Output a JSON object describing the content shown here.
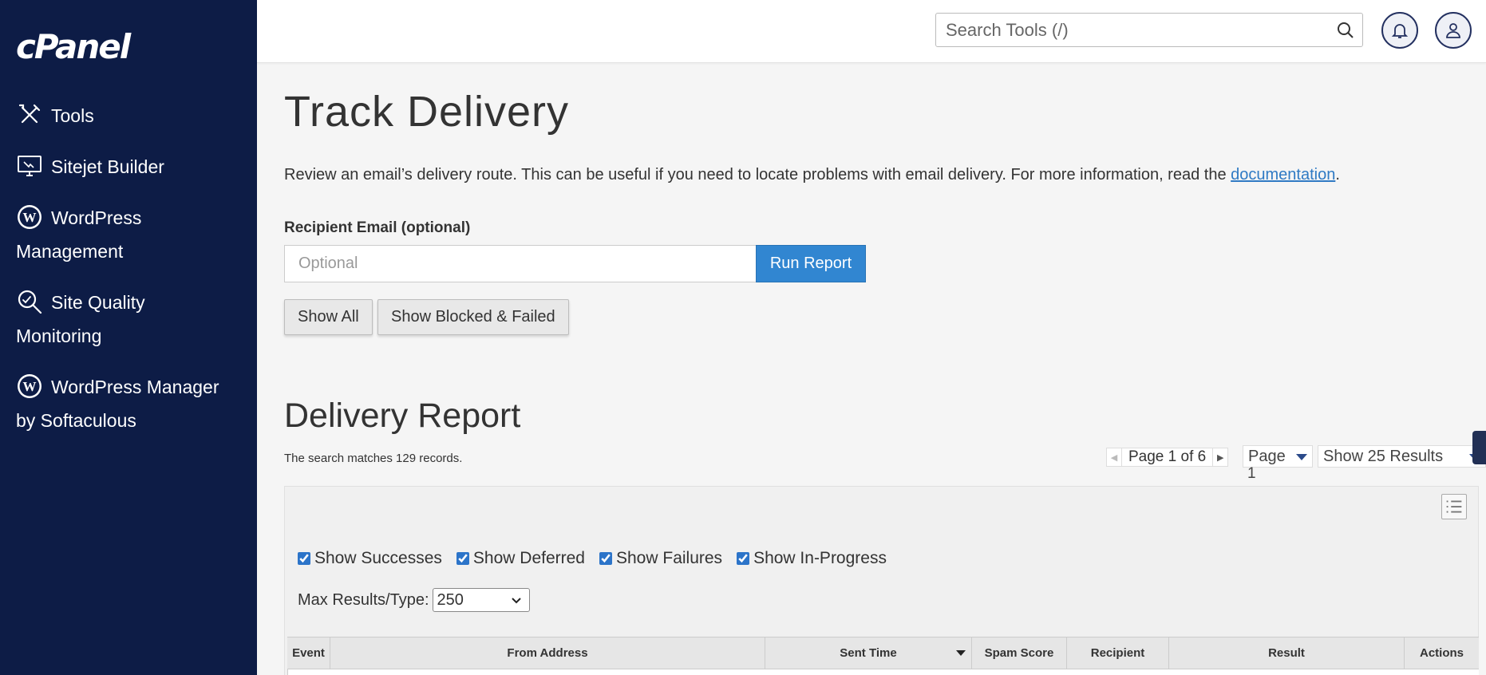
{
  "app": {
    "logo_text": "cPanel"
  },
  "sidebar": {
    "items": [
      {
        "label": "Tools",
        "icon": "tools-icon"
      },
      {
        "label": "Sitejet Builder",
        "icon": "monitor-icon"
      },
      {
        "label": "WordPress",
        "label2": "Management",
        "icon": "wordpress-icon"
      },
      {
        "label": "Site Quality",
        "label2": "Monitoring",
        "icon": "magnifier-icon"
      },
      {
        "label": "WordPress Manager",
        "label2": "by Softaculous",
        "icon": "wordpress-icon"
      }
    ]
  },
  "header": {
    "search_placeholder": "Search Tools (/)",
    "notifications_icon": "bell-icon",
    "user_icon": "user-icon"
  },
  "page": {
    "title": "Track Delivery",
    "description": "Review an email’s delivery route. This can be useful if you need to locate problems with email delivery. For more information, read the ",
    "doc_link": "documentation",
    "description_end": ".",
    "recipient_label": "Recipient Email (optional)",
    "recipient_placeholder": "Optional",
    "run_report": "Run Report",
    "show_all": "Show All",
    "show_blocked": "Show Blocked & Failed"
  },
  "report": {
    "title": "Delivery Report",
    "matches": "The search matches 129 records.",
    "pager_text": "Page 1 of 6",
    "page_select_label": "Page",
    "page_select_value": "1",
    "results_select": "Show 25 Results",
    "filters": [
      {
        "label": "Show Successes",
        "checked": true
      },
      {
        "label": "Show Deferred",
        "checked": true
      },
      {
        "label": "Show Failures",
        "checked": true
      },
      {
        "label": "Show In-Progress",
        "checked": true
      }
    ],
    "max_results_label": "Max Results/Type:",
    "max_results_value": "250",
    "columns": [
      "Event",
      "From Address",
      "Sent Time",
      "Spam Score",
      "Recipient",
      "Result",
      "Actions"
    ]
  },
  "colors": {
    "sidebar_bg": "#0d1c46",
    "accent": "#3186d1",
    "link": "#2f7ac4"
  }
}
